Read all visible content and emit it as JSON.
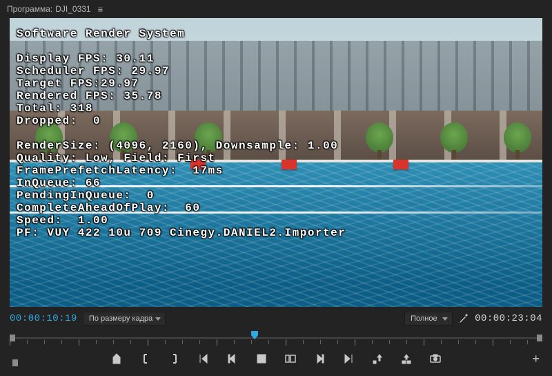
{
  "titlebar": {
    "prefix": "Программа:",
    "name": "DJI_0331",
    "menu_icon": "≡"
  },
  "overlay": {
    "title": "Software Render System",
    "lines": [
      "Display FPS: 30.11",
      "Scheduler FPS: 29.97",
      "Target FPS:29.97",
      "Rendered FPS: 35.78",
      "Total: 318",
      "Dropped:  0",
      "",
      "RenderSize: (4096, 2160), Downsample: 1.00",
      "Quality: Low, Field: First",
      "FramePrefetchLatency:  17ms",
      "InQueue: 66",
      "PendingInQueue:  0",
      "CompleteAheadOfPlay:  60",
      "Speed:  1.00",
      "PF: VUY 422 10u 709 Cinegy.DANIEL2.Importer"
    ]
  },
  "infobar": {
    "current_tc": "00:00:10:19",
    "zoom_dd": "По размеру кадра",
    "quality_dd": "Полное",
    "total_tc": "00:00:23:04"
  },
  "timeline": {
    "playhead_percent": 46
  },
  "buttons": {
    "plus": "+"
  }
}
